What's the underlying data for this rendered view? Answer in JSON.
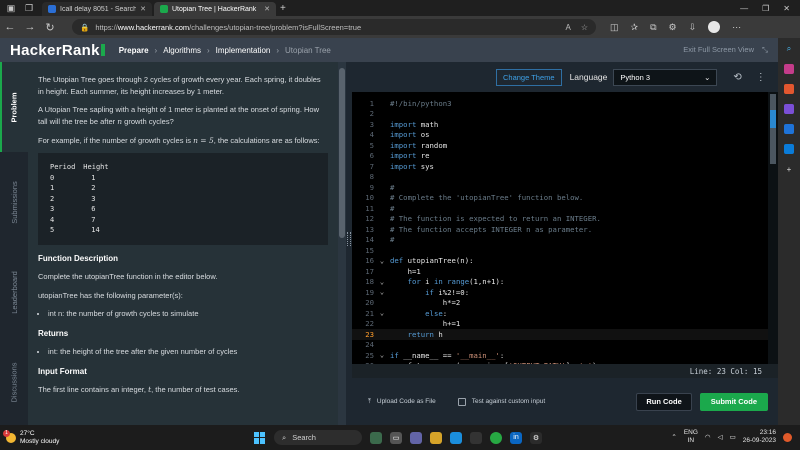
{
  "browser": {
    "tabs": [
      {
        "title": "Icall delay 8051 - Search",
        "active": false
      },
      {
        "title": "Utopian Tree | HackerRank",
        "active": true
      }
    ],
    "url_prefix": "https://",
    "url_host": "www.hackerrank.com",
    "url_path": "/challenges/utopian-tree/problem?isFullScreen=true"
  },
  "header": {
    "logo": "HackerRank",
    "crumbs": {
      "prepare": "Prepare",
      "algorithms": "Algorithms",
      "implementation": "Implementation",
      "current": "Utopian Tree"
    },
    "exit_fullscreen": "Exit Full Screen View"
  },
  "vtabs": [
    "Problem",
    "Submissions",
    "Leaderboard",
    "Discussions"
  ],
  "problem": {
    "p1": "The Utopian Tree goes through 2 cycles of growth every year. Each spring, it doubles in height. Each summer, its height increases by 1 meter.",
    "p2_a": "A Utopian Tree sapling with a height of 1 meter is planted at the onset of spring. How tall will the tree be after ",
    "p2_var": "n",
    "p2_b": " growth cycles?",
    "p3_a": "For example, if the number of growth cycles is ",
    "p3_eq": "n = 5",
    "p3_b": ", the calculations are as follows:",
    "table_head": [
      "Period",
      "Height"
    ],
    "table_rows": [
      [
        "0",
        "1"
      ],
      [
        "1",
        "2"
      ],
      [
        "2",
        "3"
      ],
      [
        "3",
        "6"
      ],
      [
        "4",
        "7"
      ],
      [
        "5",
        "14"
      ]
    ],
    "fd_title": "Function Description",
    "fd_1": "Complete the utopianTree function in the editor below.",
    "fd_2": "utopianTree has the following parameter(s):",
    "fd_param": "int n: the number of growth cycles to simulate",
    "ret_title": "Returns",
    "ret_item": "int: the height of the tree after the given number of cycles",
    "if_title": "Input Format",
    "if_a": "The first line contains an integer, ",
    "if_var": "t",
    "if_b": ", the number of test cases."
  },
  "editor": {
    "change_theme": "Change Theme",
    "language_label": "Language",
    "language": "Python 3",
    "status": "Line: 23 Col: 15",
    "upload": "Upload Code as File",
    "test_custom": "Test against custom input",
    "run": "Run Code",
    "submit": "Submit Code",
    "lines": [
      {
        "n": "1",
        "c": "#!/bin/python3"
      },
      {
        "n": "2",
        "c": ""
      },
      {
        "n": "3",
        "c": "import math"
      },
      {
        "n": "4",
        "c": "import os"
      },
      {
        "n": "5",
        "c": "import random"
      },
      {
        "n": "6",
        "c": "import re"
      },
      {
        "n": "7",
        "c": "import sys"
      },
      {
        "n": "8",
        "c": ""
      },
      {
        "n": "9",
        "c": "#"
      },
      {
        "n": "10",
        "c": "# Complete the 'utopianTree' function below."
      },
      {
        "n": "11",
        "c": "#"
      },
      {
        "n": "12",
        "c": "# The function is expected to return an INTEGER."
      },
      {
        "n": "13",
        "c": "# The function accepts INTEGER n as parameter."
      },
      {
        "n": "14",
        "c": "#"
      },
      {
        "n": "15",
        "c": ""
      },
      {
        "n": "16",
        "c": "def utopianTree(n):"
      },
      {
        "n": "17",
        "c": "    h=1"
      },
      {
        "n": "18",
        "c": "    for i in range(1,n+1):"
      },
      {
        "n": "19",
        "c": "        if i%2!=0:"
      },
      {
        "n": "20",
        "c": "            h*=2"
      },
      {
        "n": "21",
        "c": "        else:"
      },
      {
        "n": "22",
        "c": "            h+=1"
      },
      {
        "n": "23",
        "c": "    return h"
      },
      {
        "n": "24",
        "c": ""
      },
      {
        "n": "25",
        "c": "if __name__ == '__main__':"
      },
      {
        "n": "26",
        "c": "    fptr = open(os.environ['OUTPUT_PATH'], 'w')"
      }
    ]
  },
  "taskbar": {
    "temp": "27°C",
    "weather": "Mostly cloudy",
    "search": "Search",
    "lang1": "ENG",
    "lang2": "IN",
    "time": "23:16",
    "date": "26-09-2023"
  }
}
